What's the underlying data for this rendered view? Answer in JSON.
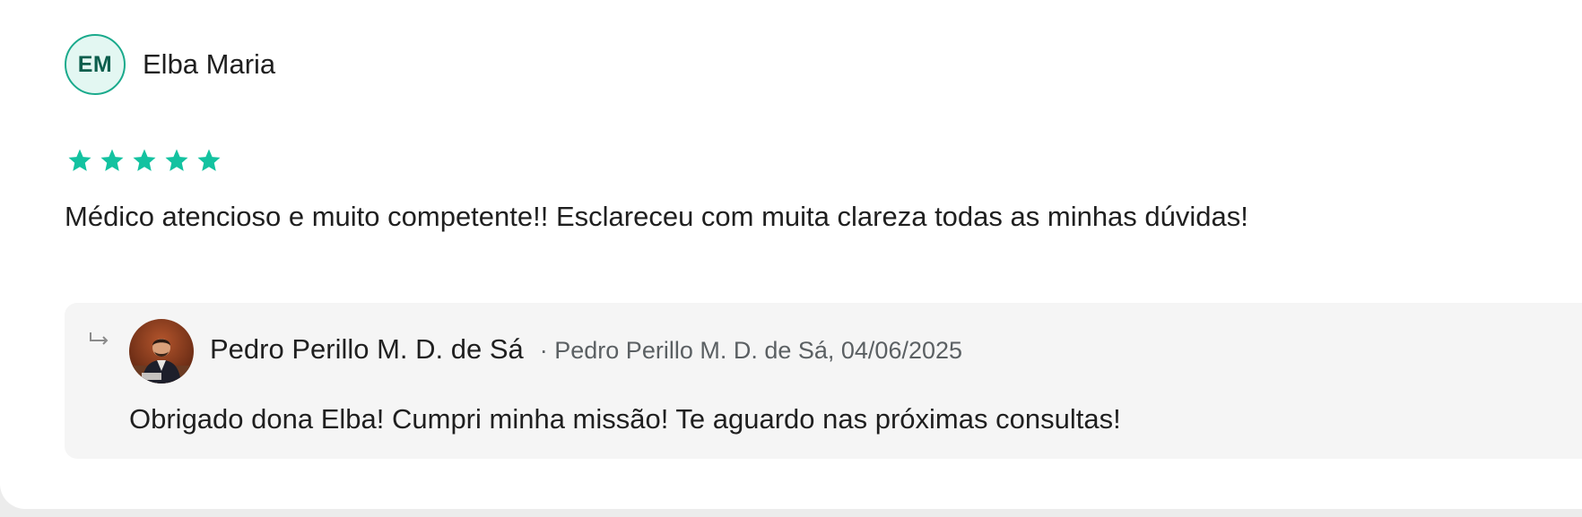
{
  "review": {
    "reviewer": {
      "initials": "EM",
      "name": "Elba Maria"
    },
    "rating": 5,
    "rating_max": 5,
    "comment": "Médico atencioso e muito competente!! Esclareceu com muita clareza todas as minhas dúvidas!"
  },
  "reply": {
    "author": "Pedro Perillo M. D. de Sá",
    "meta": "· Pedro Perillo M. D. de Sá, 04/06/2025",
    "text": "Obrigado dona Elba! Cumpri minha missão! Te aguardo nas próximas consultas!"
  },
  "icons": {
    "star": "star-icon",
    "reply": "reply-arrow-icon"
  },
  "colors": {
    "star": "#13c2a0",
    "avatar_border": "#1aaa8c",
    "avatar_bg": "#e3f7f2",
    "reply_bg": "#f5f5f5"
  }
}
